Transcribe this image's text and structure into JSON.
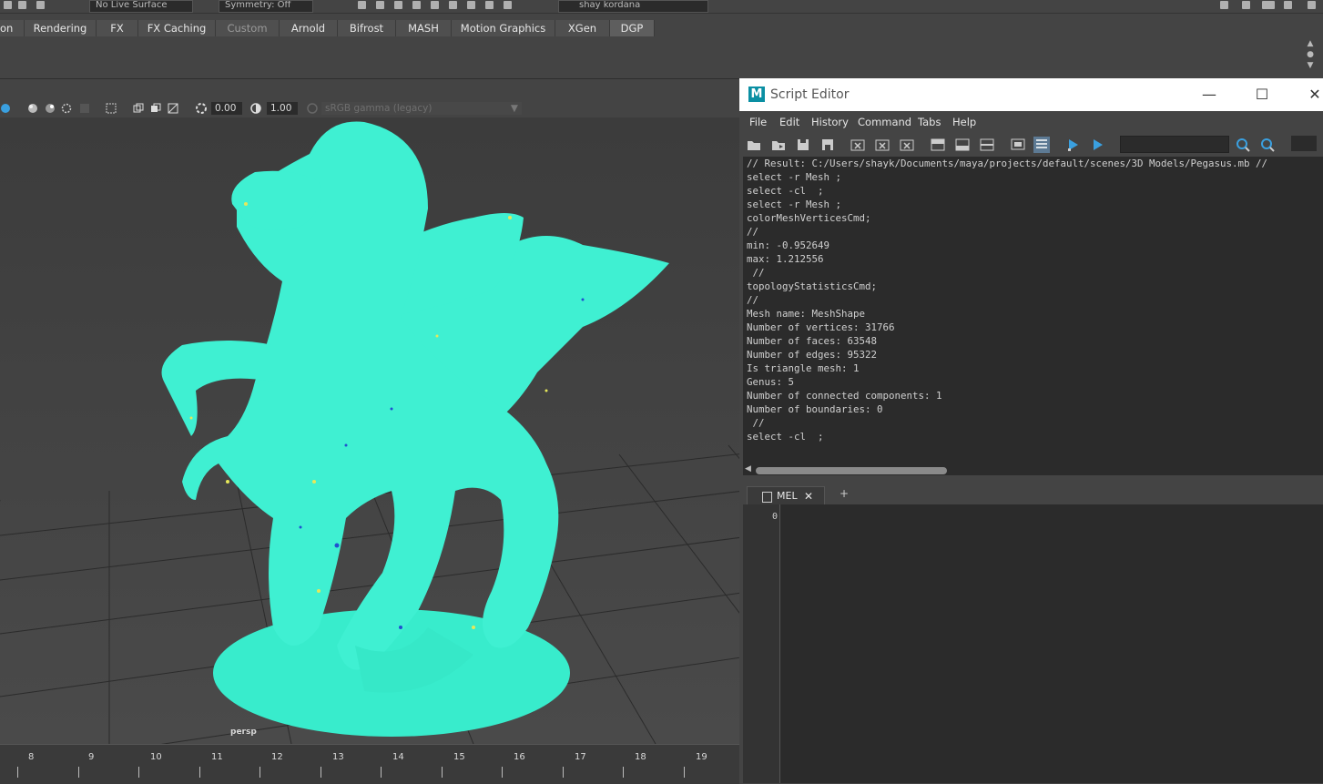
{
  "top_strip": {
    "live_surface": "No Live Surface",
    "symmetry": "Symmetry: Off",
    "user": "shay kordana"
  },
  "shelf_tabs": [
    {
      "label": "on"
    },
    {
      "label": "Rendering"
    },
    {
      "label": "FX"
    },
    {
      "label": "FX Caching"
    },
    {
      "label": "Custom"
    },
    {
      "label": "Arnold"
    },
    {
      "label": "Bifrost"
    },
    {
      "label": "MASH"
    },
    {
      "label": "Motion Graphics"
    },
    {
      "label": "XGen"
    },
    {
      "label": "DGP"
    }
  ],
  "panel_toolbar": {
    "exposure": "0.00",
    "gamma_value": "1.00",
    "colorspace": "sRGB gamma (legacy)"
  },
  "viewport": {
    "camera_label": "persp"
  },
  "timeline": {
    "frames": [
      "8",
      "9",
      "10",
      "11",
      "12",
      "13",
      "14",
      "15",
      "16",
      "17",
      "18",
      "19"
    ]
  },
  "script_editor": {
    "title": "Script Editor",
    "logo_letter": "M",
    "window_controls": {
      "minimize": "—",
      "maximize": "☐",
      "close": "✕"
    },
    "menus": [
      "File",
      "Edit",
      "History",
      "Command",
      "Tabs",
      "Help"
    ],
    "output_lines": [
      "// Result: C:/Users/shayk/Documents/maya/projects/default/scenes/3D Models/Pegasus.mb //",
      "select -r Mesh ;",
      "select -cl  ;",
      "select -r Mesh ;",
      "colorMeshVerticesCmd;",
      "//",
      "min: -0.952649",
      "max: 1.212556",
      " //",
      "topologyStatisticsCmd;",
      "//",
      "Mesh name: MeshShape",
      "Number of vertices: 31766",
      "Number of faces: 63548",
      "Number of edges: 95322",
      "Is triangle mesh: 1",
      "Genus: 5",
      "Number of connected components: 1",
      "Number of boundaries: 0",
      " //",
      "select -cl  ;"
    ],
    "tab_label": "MEL",
    "tab_close": "✕",
    "add_tab": "+",
    "line_number": "0"
  },
  "colors": {
    "mesh_fill": "#3ff0d2",
    "mesh_shade": "#2fd9c0",
    "accent_blue": "#3aa0e0",
    "maya_teal": "#0a8fa3"
  }
}
